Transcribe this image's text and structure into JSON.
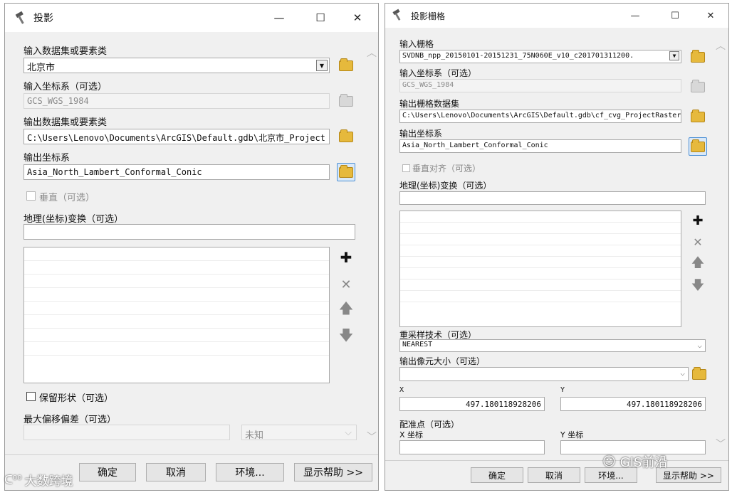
{
  "left": {
    "title": "投影",
    "titlebar_icon": "hammer-icon",
    "minimize": "—",
    "maximize": "☐",
    "close": "✕",
    "input_label": "输入数据集或要素类",
    "input_value": "北京市",
    "input_cs_label": "输入坐标系（可选）",
    "input_cs_value": "GCS_WGS_1984",
    "output_label": "输出数据集或要素类",
    "output_value": "C:\\Users\\Lenovo\\Documents\\ArcGIS\\Default.gdb\\北京市_Project",
    "output_cs_label": "输出坐标系",
    "output_cs_value": "Asia_North_Lambert_Conformal_Conic",
    "vertical_label": "垂直（可选）",
    "geo_transform_label": "地理(坐标)变换（可选）",
    "preserve_shape_label": "保留形状（可选）",
    "max_offset_label": "最大偏移偏差（可选）",
    "unit_value": "未知",
    "ok": "确定",
    "cancel": "取消",
    "env": "环境...",
    "help": "显示帮助 >>"
  },
  "right": {
    "title": "投影栅格",
    "titlebar_icon": "hammer-icon",
    "minimize": "—",
    "maximize": "☐",
    "close": "✕",
    "input_raster_label": "输入栅格",
    "input_raster_value": "SVDNB_npp_20150101-20151231_75N060E_v10_c201701311200.",
    "input_cs_label": "输入坐标系（可选）",
    "input_cs_value": "GCS_WGS_1984",
    "output_raster_label": "输出栅格数据集",
    "output_raster_value": "C:\\Users\\Lenovo\\Documents\\ArcGIS\\Default.gdb\\cf_cvg_ProjectRaster",
    "output_cs_label": "输出坐标系",
    "output_cs_value": "Asia_North_Lambert_Conformal_Conic",
    "vertical_label": "垂直对齐（可选）",
    "geo_transform_label": "地理(坐标)变换（可选）",
    "resample_label": "重采样技术（可选）",
    "resample_value": "NEAREST",
    "cell_size_label": "输出像元大小（可选）",
    "x_label": "X",
    "y_label": "Y",
    "x_value": "497.180118928206",
    "y_value": "497.180118928206",
    "registration_label": "配准点（可选）",
    "x_coord_label": "X 坐标",
    "y_coord_label": "Y 坐标",
    "ok": "确定",
    "cancel": "取消",
    "env": "环境...",
    "help": "显示帮助 >>"
  },
  "watermark_left": "大数跨境",
  "watermark_right": "GIS前沿"
}
